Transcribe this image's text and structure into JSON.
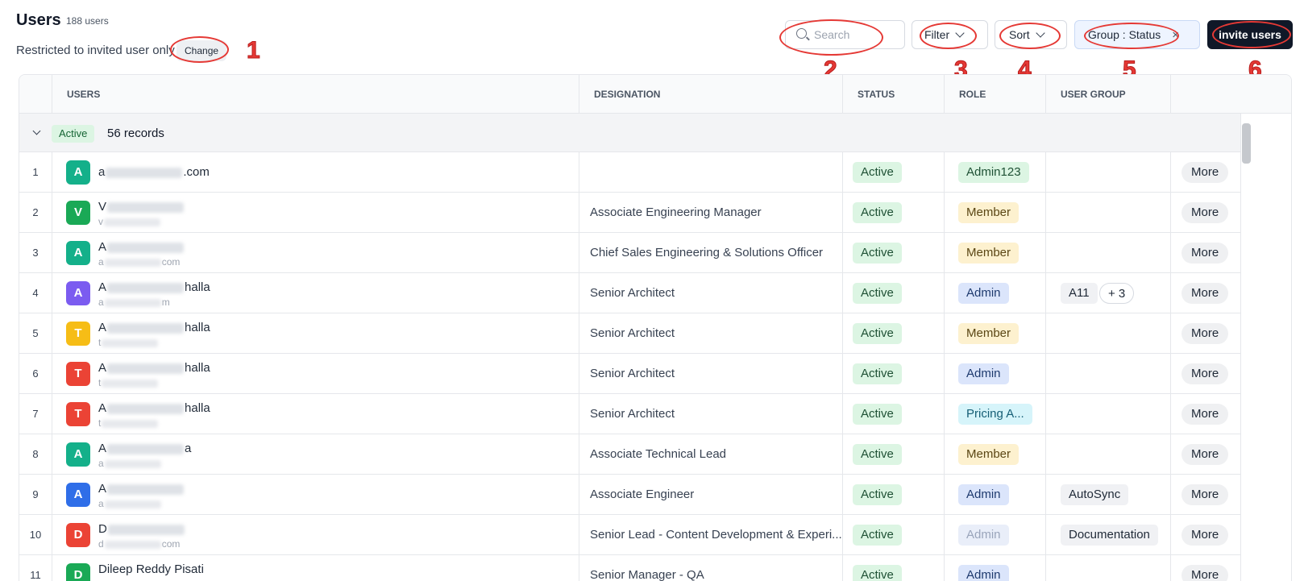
{
  "header": {
    "title": "Users",
    "count": "188 users",
    "restricted_text": "Restricted to invited user only",
    "change_label": "Change"
  },
  "toolbar": {
    "search_placeholder": "Search",
    "filter_label": "Filter",
    "sort_label": "Sort",
    "group_label": "Group : Status",
    "group_clear": "×",
    "invite_label": "invite users"
  },
  "annotations": [
    "1",
    "2",
    "3",
    "4",
    "5",
    "6"
  ],
  "columns": {
    "users": "USERS",
    "designation": "DESIGNATION",
    "status": "STATUS",
    "role": "ROLE",
    "user_group": "USER GROUP"
  },
  "group": {
    "badge": "Active",
    "records": "56 records"
  },
  "rows": [
    {
      "idx": "1",
      "avatar": "A",
      "avatar_color": "#14b08a",
      "name_pre": "a",
      "name_post": ".com",
      "email_pre": "",
      "email_post": "",
      "designation": "",
      "status": "Active",
      "role": "Admin123",
      "role_style": "admin123",
      "groups": [],
      "more": "More"
    },
    {
      "idx": "2",
      "avatar": "V",
      "avatar_color": "#1aa956",
      "name_pre": "V",
      "name_post": "",
      "email_pre": "v",
      "email_post": "",
      "designation": "Associate Engineering Manager",
      "status": "Active",
      "role": "Member",
      "role_style": "member",
      "groups": [],
      "more": "More"
    },
    {
      "idx": "3",
      "avatar": "A",
      "avatar_color": "#14b08a",
      "name_pre": "A",
      "name_post": "",
      "email_pre": "a",
      "email_post": "com",
      "designation": "Chief Sales Engineering & Solutions Officer",
      "status": "Active",
      "role": "Member",
      "role_style": "member",
      "groups": [],
      "more": "More"
    },
    {
      "idx": "4",
      "avatar": "A",
      "avatar_color": "#7b5cf0",
      "name_pre": "A",
      "name_post": "halla",
      "email_pre": "a",
      "email_post": "m",
      "designation": "Senior Architect",
      "status": "Active",
      "role": "Admin",
      "role_style": "admin",
      "groups": [
        "A11",
        "+ 3"
      ],
      "more": "More"
    },
    {
      "idx": "5",
      "avatar": "T",
      "avatar_color": "#f6bd16",
      "name_pre": "A",
      "name_post": "halla",
      "email_pre": "t",
      "email_post": "",
      "designation": "Senior Architect",
      "status": "Active",
      "role": "Member",
      "role_style": "member",
      "groups": [],
      "more": "More"
    },
    {
      "idx": "6",
      "avatar": "T",
      "avatar_color": "#eb4335",
      "name_pre": "A",
      "name_post": "halla",
      "email_pre": "t",
      "email_post": "",
      "designation": "Senior Architect",
      "status": "Active",
      "role": "Admin",
      "role_style": "admin",
      "groups": [],
      "more": "More"
    },
    {
      "idx": "7",
      "avatar": "T",
      "avatar_color": "#eb4335",
      "name_pre": "A",
      "name_post": "halla",
      "email_pre": "t",
      "email_post": "",
      "designation": "Senior Architect",
      "status": "Active",
      "role": "Pricing A...",
      "role_style": "pricing",
      "groups": [],
      "more": "More"
    },
    {
      "idx": "8",
      "avatar": "A",
      "avatar_color": "#14b08a",
      "name_pre": "A",
      "name_post": "a",
      "email_pre": "a",
      "email_post": "",
      "designation": "Associate Technical Lead",
      "status": "Active",
      "role": "Member",
      "role_style": "member",
      "groups": [],
      "more": "More"
    },
    {
      "idx": "9",
      "avatar": "A",
      "avatar_color": "#2f6ee8",
      "name_pre": "A",
      "name_post": "",
      "email_pre": "a",
      "email_post": "",
      "designation": "Associate Engineer",
      "status": "Active",
      "role": "Admin",
      "role_style": "admin",
      "groups": [
        "AutoSync"
      ],
      "more": "More"
    },
    {
      "idx": "10",
      "avatar": "D",
      "avatar_color": "#eb4335",
      "name_pre": "D",
      "name_post": "",
      "email_pre": "d",
      "email_post": "com",
      "designation": "Senior Lead - Content Development & Experi...",
      "status": "Active",
      "role": "Admin",
      "role_style": "admin-dis",
      "groups": [
        "Documentation"
      ],
      "more": "More"
    },
    {
      "idx": "11",
      "avatar": "D",
      "avatar_color": "#1aa956",
      "name_pre": "Dileep Reddy Pisati",
      "name_post": "",
      "email_pre": "",
      "email_post": "",
      "designation": "Senior Manager - QA",
      "status": "Active",
      "role": "Admin",
      "role_style": "admin",
      "groups": [],
      "more": "More"
    }
  ]
}
